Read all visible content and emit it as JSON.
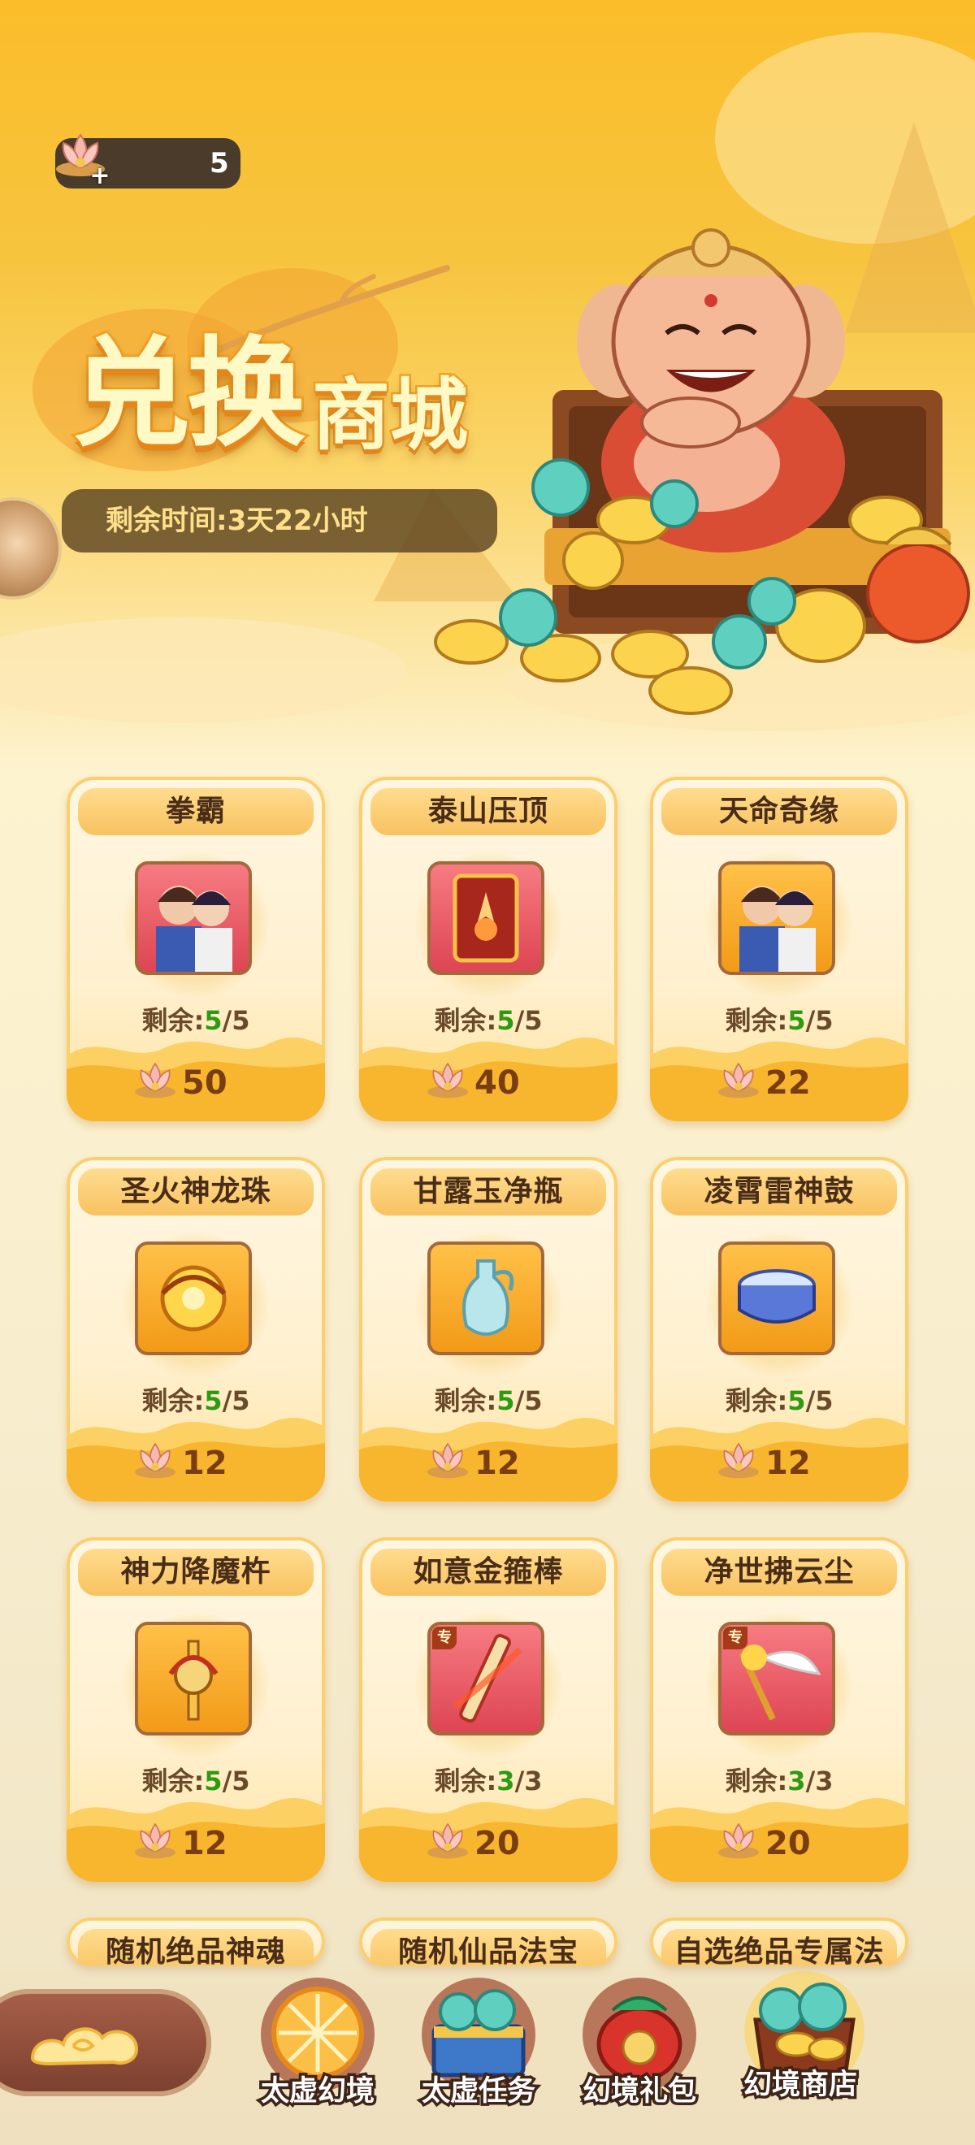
{
  "header": {
    "currency_count": "5",
    "plus": "+",
    "title_big": "兑换",
    "title_small": "商城",
    "timer": "剩余时间:3天22小时"
  },
  "remain_label": "剩余:",
  "items": [
    {
      "name": "拳霸",
      "remain": "5",
      "total": "/5",
      "price": "50",
      "icon": "heroes-portrait-icon",
      "style": "red",
      "exclusive": false
    },
    {
      "name": "泰山压顶",
      "remain": "5",
      "total": "/5",
      "price": "40",
      "icon": "skill-card-icon",
      "style": "red",
      "exclusive": false
    },
    {
      "name": "天命奇缘",
      "remain": "5",
      "total": "/5",
      "price": "22",
      "icon": "heroes-portrait-icon",
      "style": "gold",
      "exclusive": false
    },
    {
      "name": "圣火神龙珠",
      "remain": "5",
      "total": "/5",
      "price": "12",
      "icon": "dragon-pearl-icon",
      "style": "gold",
      "exclusive": false
    },
    {
      "name": "甘露玉净瓶",
      "remain": "5",
      "total": "/5",
      "price": "12",
      "icon": "jade-vase-icon",
      "style": "gold",
      "exclusive": false
    },
    {
      "name": "凌霄雷神鼓",
      "remain": "5",
      "total": "/5",
      "price": "12",
      "icon": "thunder-drum-icon",
      "style": "gold",
      "exclusive": false
    },
    {
      "name": "神力降魔杵",
      "remain": "5",
      "total": "/5",
      "price": "12",
      "icon": "vajra-pestle-icon",
      "style": "gold",
      "exclusive": false
    },
    {
      "name": "如意金箍棒",
      "remain": "3",
      "total": "/3",
      "price": "20",
      "icon": "golden-staff-icon",
      "style": "red",
      "exclusive": true,
      "badge": "专"
    },
    {
      "name": "净世拂云尘",
      "remain": "3",
      "total": "/3",
      "price": "20",
      "icon": "whisk-icon",
      "style": "red",
      "exclusive": true,
      "badge": "专"
    },
    {
      "name": "随机绝品神魂",
      "partial": true
    },
    {
      "name": "随机仙品法宝",
      "partial": true
    },
    {
      "name": "自选绝品专属法宝",
      "partial": true
    }
  ],
  "nav": [
    {
      "label": "太虚幻境",
      "icon": "lotus-orb-icon"
    },
    {
      "label": "太虚任务",
      "icon": "treasure-chest-icon"
    },
    {
      "label": "幻境礼包",
      "icon": "gift-bag-icon"
    },
    {
      "label": "幻境商店",
      "icon": "coin-pot-icon"
    }
  ],
  "colors": {
    "accent": "#f8c260",
    "remain_green": "#2d9a12",
    "dark_brown": "#4a2d18"
  }
}
